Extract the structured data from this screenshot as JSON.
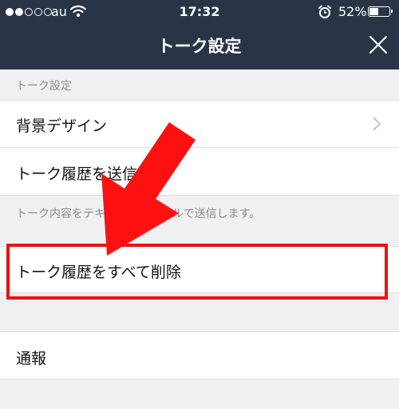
{
  "status_bar": {
    "carrier": "au",
    "time": "17:32",
    "battery_percent": "52%",
    "battery_level": 0.52,
    "signal_bars_filled": 2,
    "signal_bars_total": 5
  },
  "header": {
    "title": "トーク設定"
  },
  "sections": {
    "talk_settings_label": "トーク設定",
    "send_description": "トーク内容をテキストのファイルで送信します。"
  },
  "rows": {
    "background_design": "背景デザイン",
    "send_history": "トーク履歴を送信",
    "delete_all_history": "トーク履歴をすべて削除",
    "report": "通報"
  },
  "colors": {
    "header_bg": "#293547",
    "highlight": "#ee1111",
    "arrow": "#ff1010"
  }
}
